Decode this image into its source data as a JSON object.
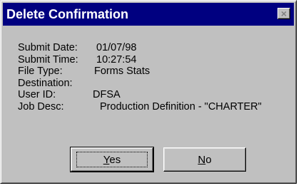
{
  "dialog": {
    "title": "Delete Confirmation",
    "close_symbol": "×"
  },
  "info": {
    "rows": [
      {
        "label": "Submit Date:",
        "value": "01/07/98"
      },
      {
        "label": "Submit Time:",
        "value": "10:27:54"
      },
      {
        "label": "File Type:",
        "value": "Forms Stats"
      },
      {
        "label": "Destination:",
        "value": ""
      },
      {
        "label": "User ID:",
        "value": "DFSA"
      },
      {
        "label": "Job Desc:",
        "value": "Production Definition - \"CHARTER\""
      }
    ]
  },
  "buttons": {
    "yes_mnemonic": "Y",
    "yes_rest": "es",
    "no_mnemonic": "N",
    "no_rest": "o"
  },
  "colors": {
    "titlebar": "#000080",
    "face": "#c0c0c0"
  }
}
